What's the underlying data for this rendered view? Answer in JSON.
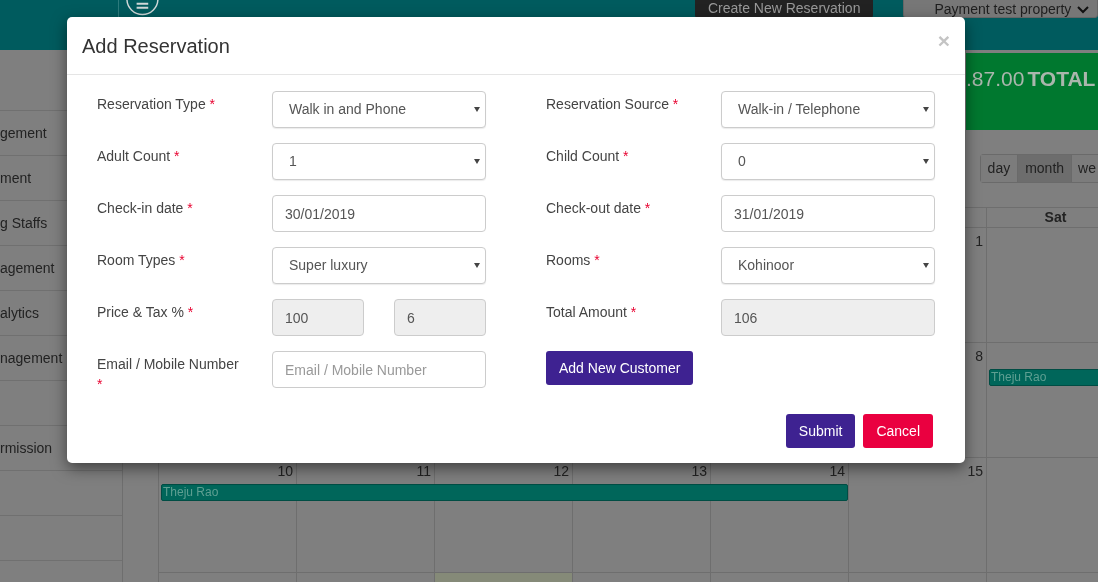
{
  "header": {
    "create_button": "Create New Reservation",
    "property_select": "Payment test property"
  },
  "sidebar": {
    "items": [
      {
        "label": "gement"
      },
      {
        "label": "ment"
      },
      {
        "label": "g Staffs"
      },
      {
        "label": "agement"
      },
      {
        "label": "alytics"
      },
      {
        "label": "nagement"
      },
      {
        "label": "rmission"
      }
    ]
  },
  "summary": {
    "amount": ".87.00",
    "label": "TOTAL"
  },
  "views": [
    {
      "label": "day",
      "selected": false
    },
    {
      "label": "month",
      "selected": true
    },
    {
      "label": "we",
      "selected": false
    }
  ],
  "calendar": {
    "day_header": "Sat",
    "weeks": [
      {
        "days": [
          "1"
        ]
      },
      {
        "days": [
          "8"
        ],
        "events": [
          {
            "title": "Theju Rao"
          }
        ]
      },
      {
        "days": [
          "10",
          "11",
          "12",
          "13",
          "14",
          "15"
        ],
        "events": [
          {
            "title": "Theju Rao"
          }
        ]
      }
    ]
  },
  "modal": {
    "title": "Add Reservation",
    "close": "×",
    "fields": [
      {
        "label": "Reservation Type",
        "required_mark": "*",
        "kind": "select",
        "value": "Walk in and Phone"
      },
      {
        "label": "Reservation Source",
        "required_mark": "*",
        "kind": "select",
        "value": "Walk-in / Telephone"
      },
      {
        "label": "Adult Count",
        "required_mark": "*",
        "kind": "select",
        "value": "1"
      },
      {
        "label": "Child Count",
        "required_mark": "*",
        "kind": "select",
        "value": "0"
      },
      {
        "label": "Check-in date",
        "required_mark": "*",
        "kind": "input",
        "value": "30/01/2019"
      },
      {
        "label": "Check-out date",
        "required_mark": "*",
        "kind": "input",
        "value": "31/01/2019"
      },
      {
        "label": "Room Types",
        "required_mark": "*",
        "kind": "select",
        "value": "Super luxury"
      },
      {
        "label": "Rooms",
        "required_mark": "*",
        "kind": "select",
        "value": "Kohinoor"
      },
      {
        "label": "Price & Tax %",
        "required_mark": "*",
        "kind": "pair",
        "values": [
          "100",
          "6"
        ],
        "disabled": true
      },
      {
        "label": "Total Amount",
        "required_mark": "*",
        "kind": "input",
        "value": "106",
        "disabled": true
      },
      {
        "label": "Email / Mobile Number",
        "required_mark": "*",
        "kind": "input",
        "placeholder": "Email / Mobile Number"
      },
      {
        "kind": "button",
        "text": "Add New Customer"
      }
    ],
    "buttons": [
      {
        "label": "Submit",
        "kind": "primary"
      },
      {
        "label": "Cancel",
        "kind": "danger"
      }
    ]
  }
}
